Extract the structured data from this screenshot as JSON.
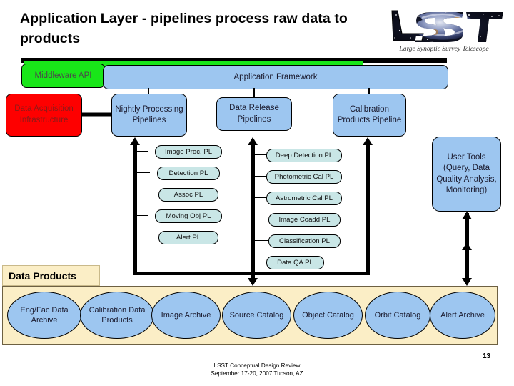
{
  "slide": {
    "title": "Application Layer - pipelines process raw data to products",
    "page_number": "13",
    "footer_line1": "LSST Conceptual Design Review",
    "footer_line2": "September 17-20, 2007  Tucson, AZ"
  },
  "logo": {
    "wordmark": "LSST",
    "tagline": "Large Synoptic Survey Telescope"
  },
  "layers": {
    "middleware_api": "Middleware API",
    "application_framework": "Application Framework",
    "data_acquisition": "Data Acquisition Infrastructure"
  },
  "pipelines": {
    "nightly": "Nightly Processing Pipelines",
    "data_release": "Data Release Pipelines",
    "calibration": "Calibration Products Pipeline",
    "user_tools": "User Tools (Query, Data Quality Analysis, Monitoring)"
  },
  "nightly_list": [
    "Image Proc. PL",
    "Detection PL",
    "Assoc PL",
    "Moving Obj PL",
    "Alert PL"
  ],
  "release_list": [
    "Deep Detection PL",
    "Photometric Cal PL",
    "Astrometric Cal PL",
    "Image Coadd PL",
    "Classification PL",
    "Data QA PL"
  ],
  "data_products": {
    "label": "Data Products",
    "items": [
      "Eng/Fac Data Archive",
      "Calibration Data Products",
      "Image Archive",
      "Source Catalog",
      "Object Catalog",
      "Orbit Catalog",
      "Alert Archive"
    ]
  },
  "colors": {
    "middleware_green": "#19e619",
    "framework_blue": "#9dc6f0",
    "daq_red": "#fe0000",
    "pipeline_pill": "#c9e6e6",
    "data_products_band": "#fbeec6"
  }
}
